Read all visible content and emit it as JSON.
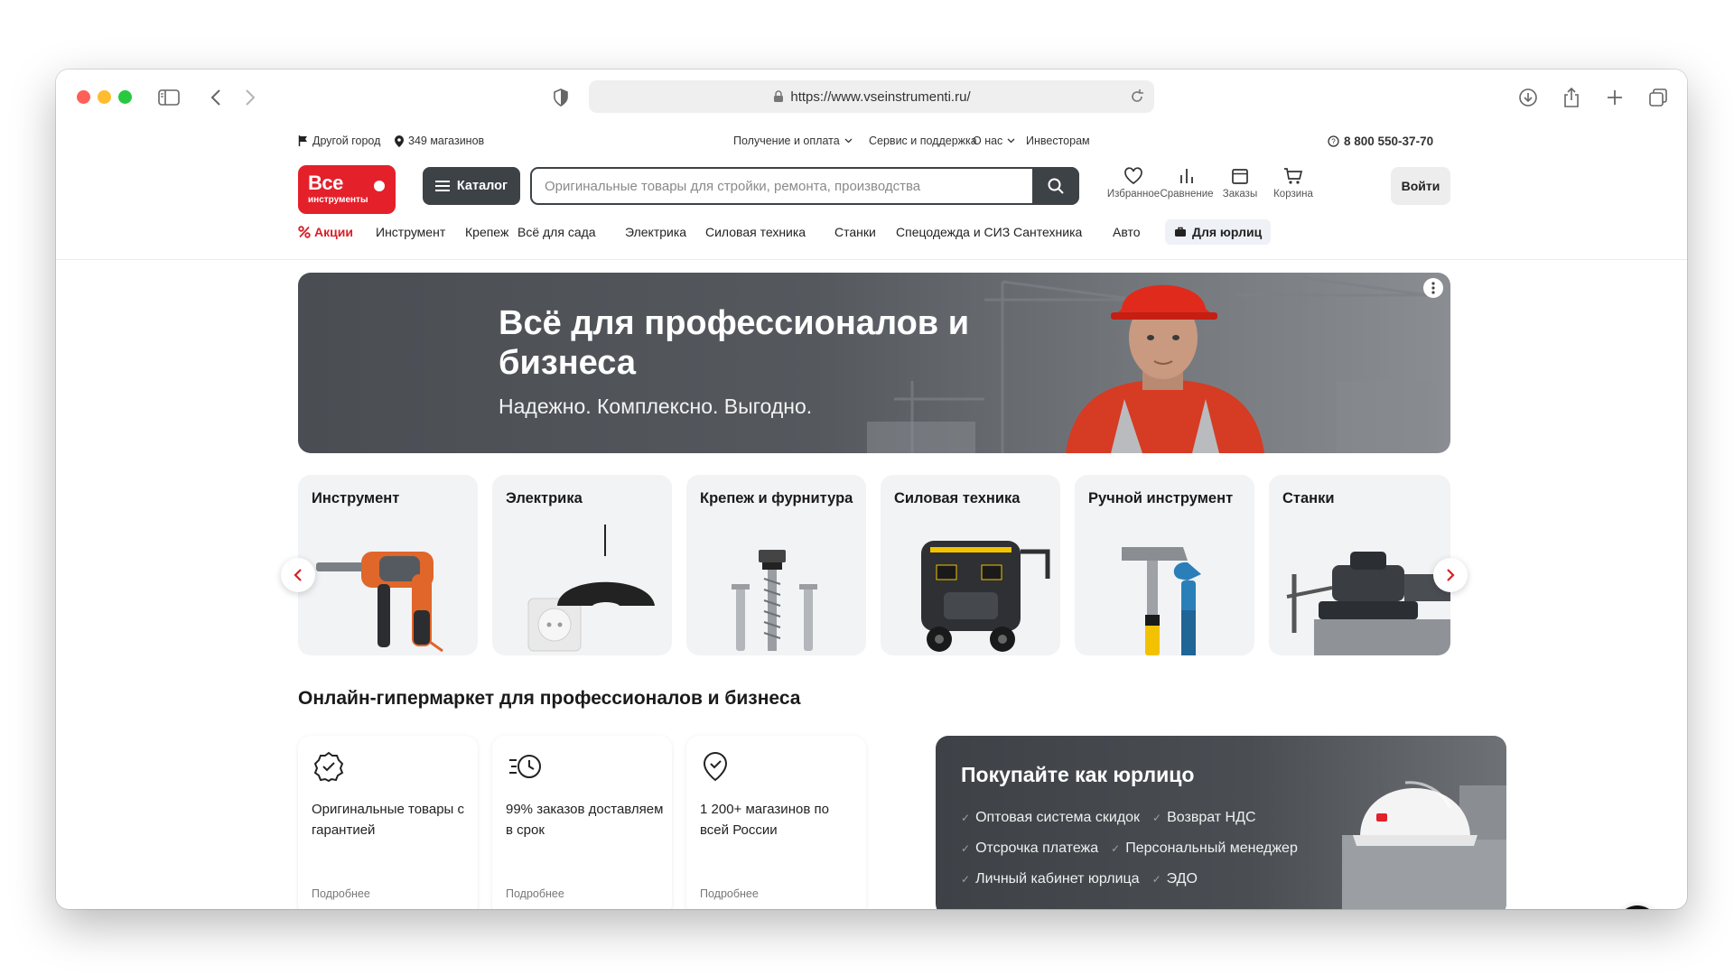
{
  "browser": {
    "url": "https://www.vseinstrumenti.ru/"
  },
  "topbar": {
    "city": "Другой город",
    "stores": "349 магазинов",
    "links": [
      "Получение и оплата",
      "Сервис и поддержка",
      "О нас",
      "Инвесторам"
    ],
    "phone": "8 800 550-37-70"
  },
  "header": {
    "logo_line1": "Все",
    "logo_line2": "инструменты",
    "catalog_label": "Каталог",
    "search_placeholder": "Оригинальные товары для стройки, ремонта, производства",
    "icons": [
      "Избранное",
      "Сравнение",
      "Заказы",
      "Корзина"
    ],
    "login_label": "Войти"
  },
  "nav": {
    "promo": "Акции",
    "items": [
      "Инструмент",
      "Крепеж",
      "Всё для сада",
      "Электрика",
      "Силовая техника",
      "Станки",
      "Спецодежда и СИЗ",
      "Сантехника",
      "Авто"
    ],
    "b2b": "Для юрлиц"
  },
  "banner": {
    "title": "Всё для профессионалов и бизнеса",
    "subtitle": "Надежно. Комплексно. Выгодно."
  },
  "categories": [
    "Инструмент",
    "Электрика",
    "Крепеж и фурнитура",
    "Силовая техника",
    "Ручной инструмент",
    "Станки"
  ],
  "section_title": "Онлайн-гипермаркет для профессионалов и бизнеса",
  "features": [
    {
      "text": "Оригинальные товары с гарантией",
      "more": "Подробнее"
    },
    {
      "text": "99% заказов доставляем в срок",
      "more": "Подробнее"
    },
    {
      "text": "1 200+ магазинов по всей России",
      "more": "Подробнее"
    }
  ],
  "b2b_card": {
    "title": "Покупайте как юрлицо",
    "items": [
      "Оптовая система скидок",
      "Возврат НДС",
      "Отсрочка платежа",
      "Персональный менеджер",
      "Личный кабинет юрлица",
      "ЭДО"
    ]
  },
  "colors": {
    "brand_red": "#e4202b",
    "dark": "#3d4246"
  }
}
